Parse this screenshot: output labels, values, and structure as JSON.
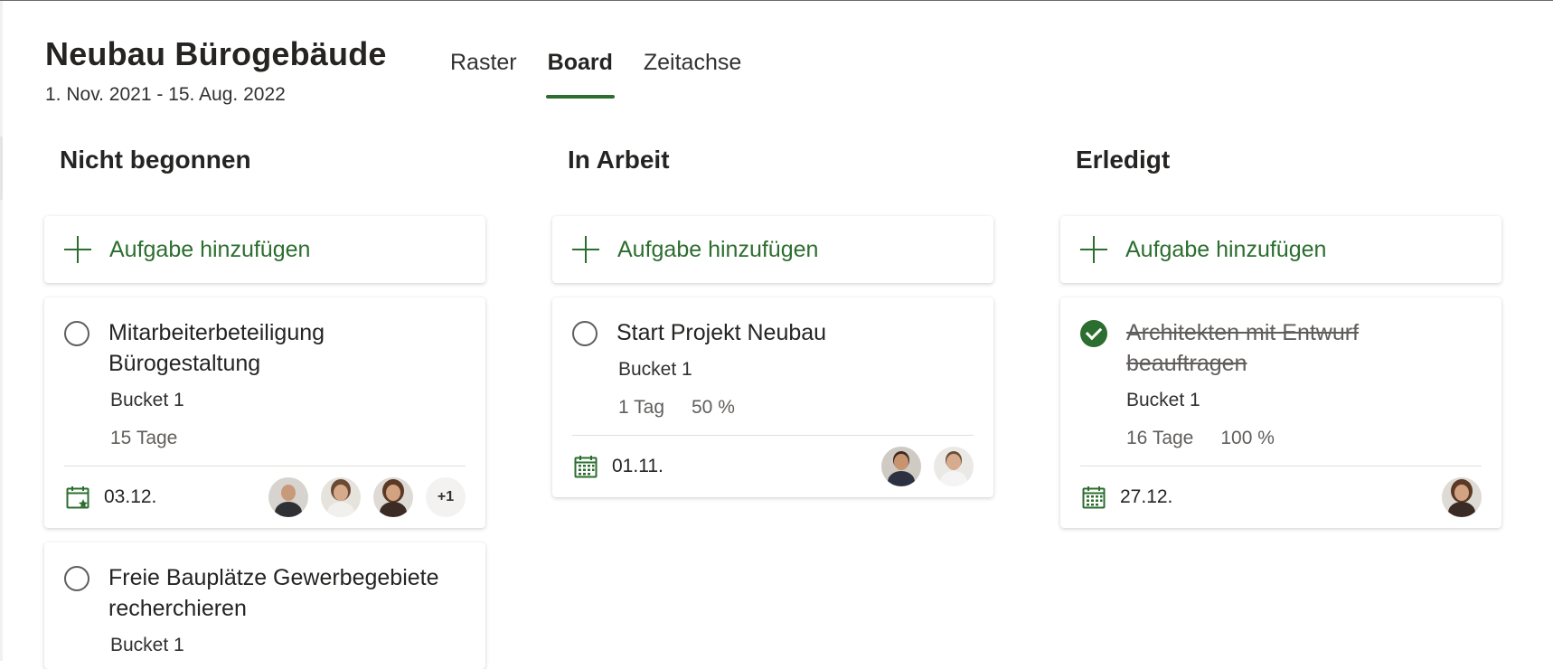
{
  "plan": {
    "title": "Neubau Bürogebäude",
    "dates": "1. Nov. 2021 - 15. Aug. 2022"
  },
  "tabs": [
    {
      "label": "Raster",
      "active": false
    },
    {
      "label": "Board",
      "active": true
    },
    {
      "label": "Zeitachse",
      "active": false
    }
  ],
  "columns": [
    {
      "title": "Nicht begonnen",
      "add_label": "Aufgabe hinzufügen",
      "tasks": [
        {
          "title": "Mitarbeiterbeteiligung Bürogestaltung",
          "bucket": "Bucket 1",
          "duration": "15 Tage",
          "due": "03.12.",
          "more": "+1"
        },
        {
          "title": "Freie Bauplätze Gewerbegebiete recherchieren",
          "bucket": "Bucket 1"
        }
      ]
    },
    {
      "title": "In Arbeit",
      "add_label": "Aufgabe hinzufügen",
      "tasks": [
        {
          "title": "Start Projekt Neubau",
          "bucket": "Bucket 1",
          "duration": "1 Tag",
          "progress": "50 %",
          "due": "01.11."
        }
      ]
    },
    {
      "title": "Erledigt",
      "add_label": "Aufgabe hinzufügen",
      "tasks": [
        {
          "title": "Architekten mit Entwurf beauftragen",
          "bucket": "Bucket 1",
          "duration": "16 Tage",
          "progress": "100 %",
          "due": "27.12."
        }
      ]
    }
  ],
  "colors": {
    "accent": "#2c6e2f",
    "text": "#252423",
    "muted": "#605e5c"
  },
  "icons": [
    "plus-icon",
    "circle-icon",
    "check-circle-icon",
    "calendar-icon",
    "calendar-star-icon"
  ]
}
